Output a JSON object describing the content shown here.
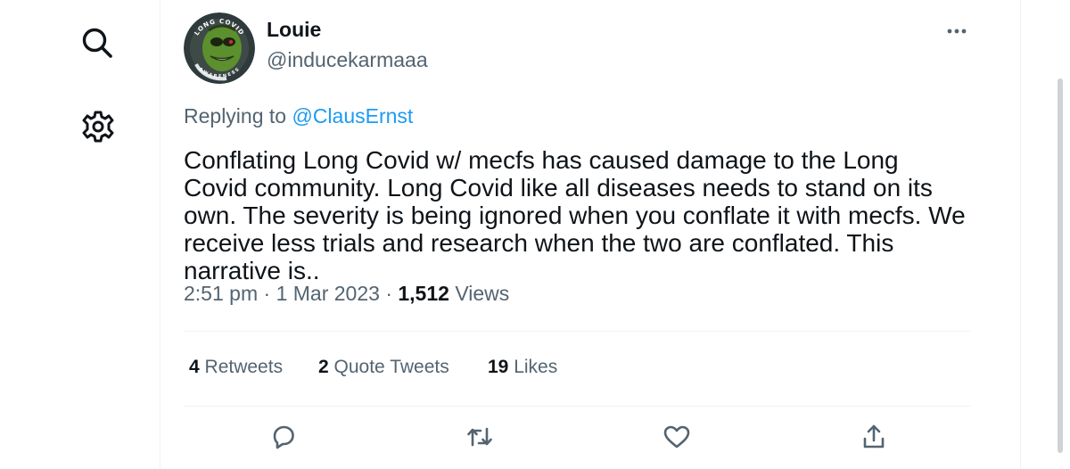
{
  "nav": {
    "icons": [
      "search-icon",
      "settings-gear-icon"
    ]
  },
  "tweet": {
    "author": {
      "display_name": "Louie",
      "handle": "@inducekarmaaa",
      "avatar_badge_top": "LONG COVID",
      "avatar_badge_bottom": "AWARENESS"
    },
    "replying_prefix": "Replying to",
    "replying_to": "@ClausErnst",
    "text": "Conflating Long Covid w/ mecfs has caused damage to the Long Covid community. Long Covid like all diseases needs to stand on its own. The severity is being ignored when you conflate it with mecfs. We receive less trials and research when the two are conflated. This narrative is..",
    "time": "2:51 pm",
    "date": "1 Mar 2023",
    "separator": "·",
    "views_count": "1,512",
    "views_label": "Views",
    "stats": {
      "retweets_count": "4",
      "retweets_label": "Retweets",
      "quotes_count": "2",
      "quotes_label": "Quote Tweets",
      "likes_count": "19",
      "likes_label": "Likes"
    },
    "actions": [
      "reply-icon",
      "retweet-icon",
      "like-icon",
      "share-icon"
    ]
  },
  "colors": {
    "text_primary": "#0f1419",
    "text_secondary": "#536471",
    "accent": "#1d9bf0",
    "divider": "#eff3f4"
  }
}
